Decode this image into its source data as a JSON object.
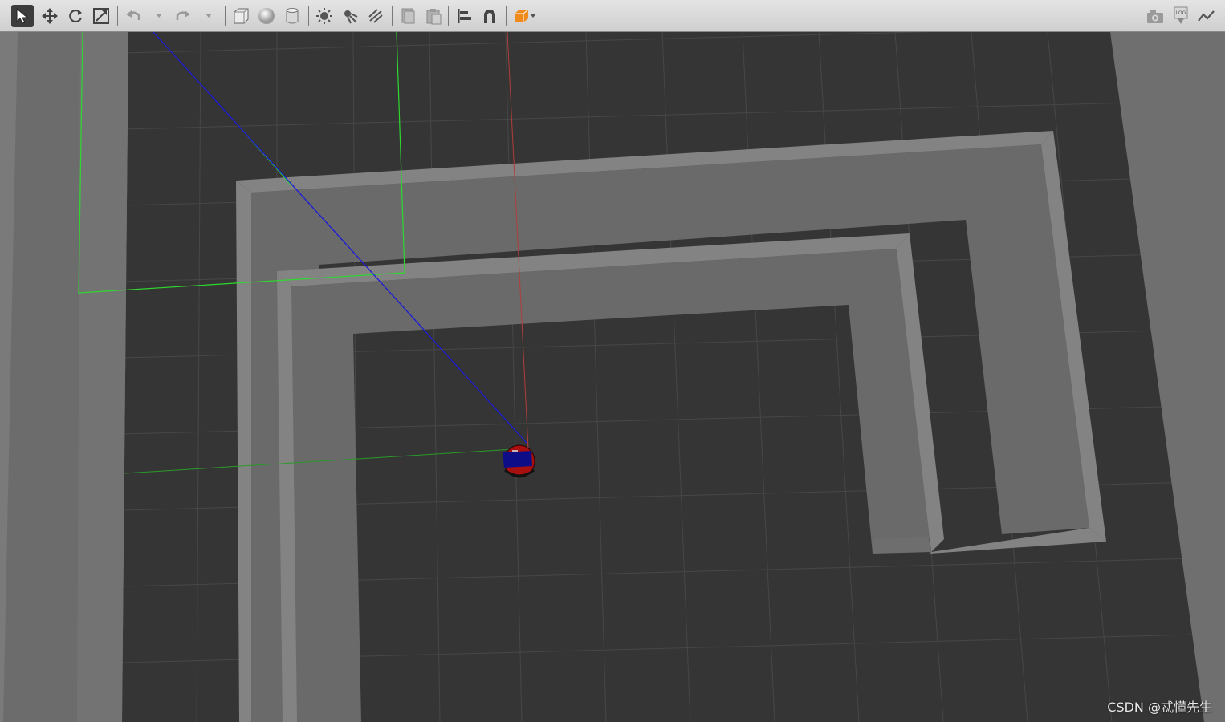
{
  "toolbar": {
    "tools": [
      {
        "name": "select-mode",
        "icon": "arrow-cursor-icon",
        "active": true
      },
      {
        "name": "translate-mode",
        "icon": "move-arrows-icon"
      },
      {
        "name": "rotate-mode",
        "icon": "rotate-icon"
      },
      {
        "name": "scale-mode",
        "icon": "scale-icon"
      },
      {
        "name": "undo",
        "icon": "undo-icon"
      },
      {
        "name": "redo",
        "icon": "redo-icon"
      },
      {
        "name": "insert-box",
        "icon": "box-icon"
      },
      {
        "name": "insert-sphere",
        "icon": "sphere-icon"
      },
      {
        "name": "insert-cylinder",
        "icon": "cylinder-icon"
      },
      {
        "name": "point-light",
        "icon": "sun-icon"
      },
      {
        "name": "spot-light",
        "icon": "spotlight-icon"
      },
      {
        "name": "directional-light",
        "icon": "directional-light-icon"
      },
      {
        "name": "copy",
        "icon": "copy-icon"
      },
      {
        "name": "paste",
        "icon": "paste-icon"
      },
      {
        "name": "align",
        "icon": "align-icon"
      },
      {
        "name": "snap",
        "icon": "magnet-icon"
      },
      {
        "name": "view-angle",
        "icon": "orange-cube-icon"
      },
      {
        "name": "screenshot",
        "icon": "camera-icon"
      },
      {
        "name": "log",
        "icon": "log-icon"
      },
      {
        "name": "plot",
        "icon": "plot-icon"
      }
    ],
    "log_label": "LOG"
  },
  "scene": {
    "colors": {
      "ground": "#353535",
      "grid": "#4a4a4a",
      "wall_top": "#828282",
      "wall_side": "#6a6a6a",
      "outer_wall": "#777777",
      "green": "#2fd82f",
      "blue": "#1a1ad8",
      "red": "#b43c3c",
      "robot_body": "#a80f0f",
      "robot_panel": "#0d0d88"
    }
  },
  "watermark": "CSDN @忒懂先生"
}
